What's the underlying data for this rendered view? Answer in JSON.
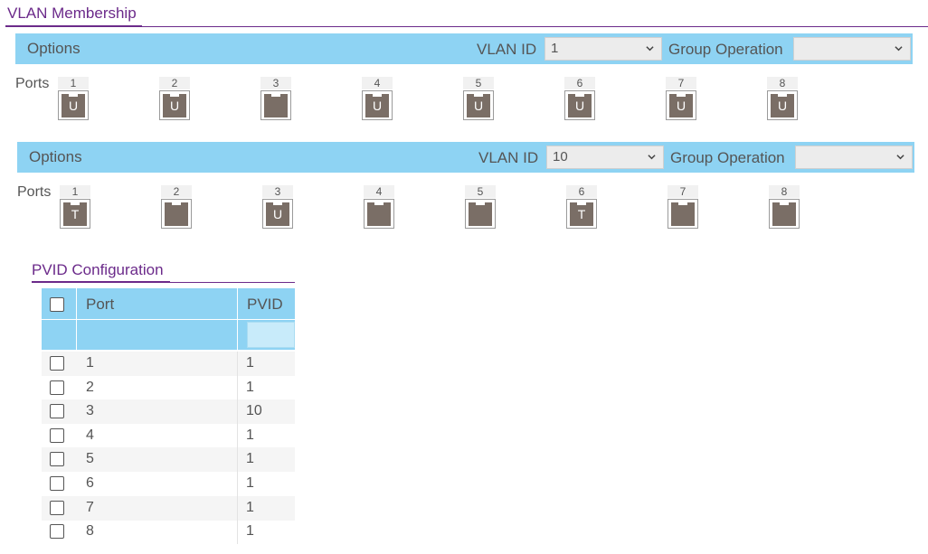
{
  "vlan_membership": {
    "title": "VLAN Membership",
    "panels": [
      {
        "options_label": "Options",
        "vlan_id_label": "VLAN ID",
        "vlan_id_value": "1",
        "group_operation_label": "Group Operation",
        "group_operation_value": "",
        "ports_label": "Ports",
        "ports": [
          {
            "number": "1",
            "mode": "U"
          },
          {
            "number": "2",
            "mode": "U"
          },
          {
            "number": "3",
            "mode": ""
          },
          {
            "number": "4",
            "mode": "U"
          },
          {
            "number": "5",
            "mode": "U"
          },
          {
            "number": "6",
            "mode": "U"
          },
          {
            "number": "7",
            "mode": "U"
          },
          {
            "number": "8",
            "mode": "U"
          }
        ]
      },
      {
        "options_label": "Options",
        "vlan_id_label": "VLAN ID",
        "vlan_id_value": "10",
        "group_operation_label": "Group Operation",
        "group_operation_value": "",
        "ports_label": "Ports",
        "ports": [
          {
            "number": "1",
            "mode": "T"
          },
          {
            "number": "2",
            "mode": ""
          },
          {
            "number": "3",
            "mode": "U"
          },
          {
            "number": "4",
            "mode": ""
          },
          {
            "number": "5",
            "mode": ""
          },
          {
            "number": "6",
            "mode": "T"
          },
          {
            "number": "7",
            "mode": ""
          },
          {
            "number": "8",
            "mode": ""
          }
        ]
      }
    ]
  },
  "pvid_configuration": {
    "title": "PVID Configuration",
    "columns": [
      "Port",
      "PVID"
    ],
    "rows": [
      {
        "port": "1",
        "pvid": "1"
      },
      {
        "port": "2",
        "pvid": "1"
      },
      {
        "port": "3",
        "pvid": "10"
      },
      {
        "port": "4",
        "pvid": "1"
      },
      {
        "port": "5",
        "pvid": "1"
      },
      {
        "port": "6",
        "pvid": "1"
      },
      {
        "port": "7",
        "pvid": "1"
      },
      {
        "port": "8",
        "pvid": "1"
      }
    ]
  },
  "colors": {
    "accent": "#6b2a8a",
    "header_bg": "#8ed3f3",
    "port_body": "#7a6e66"
  }
}
